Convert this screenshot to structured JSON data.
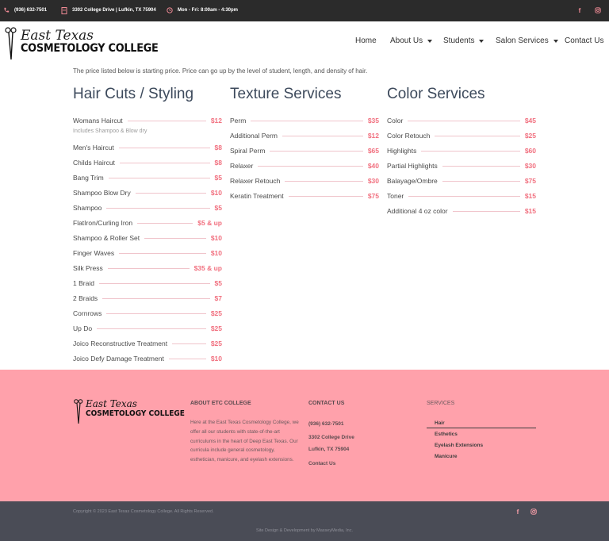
{
  "topbar": {
    "phone": "(936) 632-7501",
    "address": "3302 College Drive | Lufkin, TX 75904",
    "hours": "Mon - Fri: 8:00am - 4:30pm",
    "icons": [
      "phone-icon",
      "building-icon",
      "clock-icon",
      "facebook-icon",
      "instagram-icon"
    ]
  },
  "brand": {
    "script": "East Texas",
    "block": "COSMETOLOGY COLLEGE"
  },
  "nav": {
    "home": "Home",
    "about": "About Us",
    "students": "Students",
    "salon": "Salon Services",
    "contact": "Contact Us"
  },
  "intro": "The price listed below is starting price.  Price can go up by the level of student, length, and density of hair.",
  "columns": [
    {
      "title": "Hair Cuts / Styling",
      "items": [
        {
          "name": "Womans Haircut",
          "price": "$12"
        },
        {
          "name": "Men's Haircut",
          "price": "$8"
        },
        {
          "name": "Childs Haircut",
          "price": "$8"
        },
        {
          "name": "Bang Trim",
          "price": "$5"
        },
        {
          "name": "Shampoo Blow Dry",
          "price": "$10"
        },
        {
          "name": "Shampoo",
          "price": "$5"
        },
        {
          "name": "FlatIron/Curling Iron",
          "price": "$5 & up"
        },
        {
          "name": "Shampoo & Roller Set",
          "price": "$10"
        },
        {
          "name": "Finger Waves",
          "price": "$10"
        },
        {
          "name": "Silk Press",
          "price": "$35 & up"
        },
        {
          "name": "1 Braid",
          "price": "$5"
        },
        {
          "name": "2 Braids",
          "price": "$7"
        },
        {
          "name": "Cornrows",
          "price": "$25"
        },
        {
          "name": "Up Do",
          "price": "$25"
        },
        {
          "name": "Joico Reconstructive Treatment",
          "price": "$25"
        },
        {
          "name": "Joico Defy Damage Treatment",
          "price": "$10"
        }
      ],
      "note": "Includes Shampoo & Blow dry"
    },
    {
      "title": "Texture Services",
      "items": [
        {
          "name": "Perm",
          "price": "$35"
        },
        {
          "name": "Additional Perm",
          "price": "$12"
        },
        {
          "name": "Spiral Perm",
          "price": "$65"
        },
        {
          "name": "Relaxer",
          "price": "$40"
        },
        {
          "name": "Relaxer Retouch",
          "price": "$30"
        },
        {
          "name": "Keratin Treatment",
          "price": "$75"
        }
      ]
    },
    {
      "title": "Color Services",
      "items": [
        {
          "name": "Color",
          "price": "$45"
        },
        {
          "name": "Color Retouch",
          "price": "$25"
        },
        {
          "name": "Highlights",
          "price": "$60"
        },
        {
          "name": "Partial Highlights",
          "price": "$30"
        },
        {
          "name": "Balayage/Ombre",
          "price": "$75"
        },
        {
          "name": "Toner",
          "price": "$15"
        },
        {
          "name": "Additional 4 oz color",
          "price": "$15"
        }
      ]
    }
  ],
  "footer": {
    "about_title": "ABOUT ETC COLLEGE",
    "about_text": "Here at the East Texas Cosmetology College, we offer all our students with state-of-the-art curriculums in the heart of Deep East Texas. Our curricula include general cosmetology, esthetician, manicure, and eyelash extensions.",
    "contact_title": "CONTACT US",
    "contact_phone": "(936) 632-7501",
    "contact_street": "3302 College Drive",
    "contact_city": "Lufkin, TX 75904",
    "contact_link": "Contact Us",
    "services_title": "SERVICES",
    "services": [
      "Hair",
      "Esthetics",
      "Eyelash Extensions",
      "Manicure"
    ],
    "copyright": "Copyright © 2023 East Texas Cosmetology College. All Rights Reserved.",
    "credit": "Site Design & Development by MasseyMedia, Inc."
  },
  "colors": {
    "accent": "#f1707f",
    "footer_pink": "#ffa1ab",
    "dark_bar": "#2b2b2b",
    "bottom_bar": "#4a4c56",
    "heading": "#3d4a5c"
  }
}
